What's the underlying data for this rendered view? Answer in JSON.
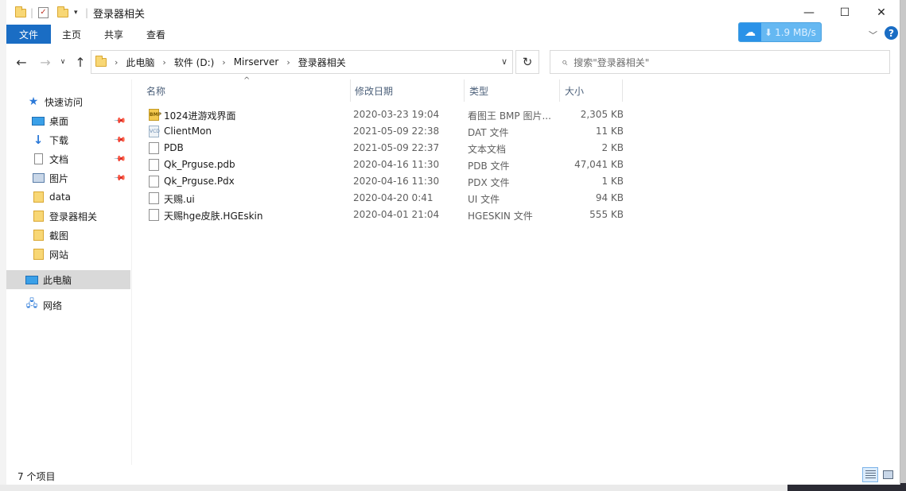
{
  "window": {
    "title": "登录器相关",
    "controls": {
      "minimize": "—",
      "maximize": "☐",
      "close": "✕"
    }
  },
  "ribbon": {
    "tabs": [
      "文件",
      "主页",
      "共享",
      "查看"
    ],
    "speed": "1.9 MB/s"
  },
  "address": {
    "crumbs": [
      "此电脑",
      "软件 (D:)",
      "Mirserver",
      "登录器相关"
    ],
    "search_placeholder": "搜索\"登录器相关\""
  },
  "nav_pane": {
    "quick_access": "快速访问",
    "items": [
      {
        "label": "桌面",
        "icon": "desktop-icon",
        "pinned": true
      },
      {
        "label": "下载",
        "icon": "download-icon",
        "pinned": true
      },
      {
        "label": "文档",
        "icon": "document-icon",
        "pinned": true
      },
      {
        "label": "图片",
        "icon": "pictures-icon",
        "pinned": true
      },
      {
        "label": "data",
        "icon": "folder-icon",
        "pinned": false
      },
      {
        "label": "登录器相关",
        "icon": "folder-icon",
        "pinned": false
      },
      {
        "label": "截图",
        "icon": "folder-icon",
        "pinned": false
      },
      {
        "label": "网站",
        "icon": "folder-icon",
        "pinned": false
      }
    ],
    "this_pc": "此电脑",
    "network": "网络"
  },
  "columns": {
    "name": "名称",
    "date": "修改日期",
    "type": "类型",
    "size": "大小"
  },
  "files": [
    {
      "name": "1024进游戏界面",
      "date": "2020-03-23 19:04",
      "type": "看图王 BMP 图片...",
      "size": "2,305 KB",
      "icon": "bmp"
    },
    {
      "name": "ClientMon",
      "date": "2021-05-09 22:38",
      "type": "DAT 文件",
      "size": "11 KB",
      "icon": "vcd"
    },
    {
      "name": "PDB",
      "date": "2021-05-09 22:37",
      "type": "文本文档",
      "size": "2 KB",
      "icon": "txt"
    },
    {
      "name": "Qk_Prguse.pdb",
      "date": "2020-04-16 11:30",
      "type": "PDB 文件",
      "size": "47,041 KB",
      "icon": "file"
    },
    {
      "name": "Qk_Prguse.Pdx",
      "date": "2020-04-16 11:30",
      "type": "PDX 文件",
      "size": "1 KB",
      "icon": "file"
    },
    {
      "name": "天赐.ui",
      "date": "2020-04-20 0:41",
      "type": "UI 文件",
      "size": "94 KB",
      "icon": "file"
    },
    {
      "name": "天赐hge皮肤.HGEskin",
      "date": "2020-04-01 21:04",
      "type": "HGESKIN 文件",
      "size": "555 KB",
      "icon": "file"
    }
  ],
  "status": {
    "count": "7 个项目"
  }
}
